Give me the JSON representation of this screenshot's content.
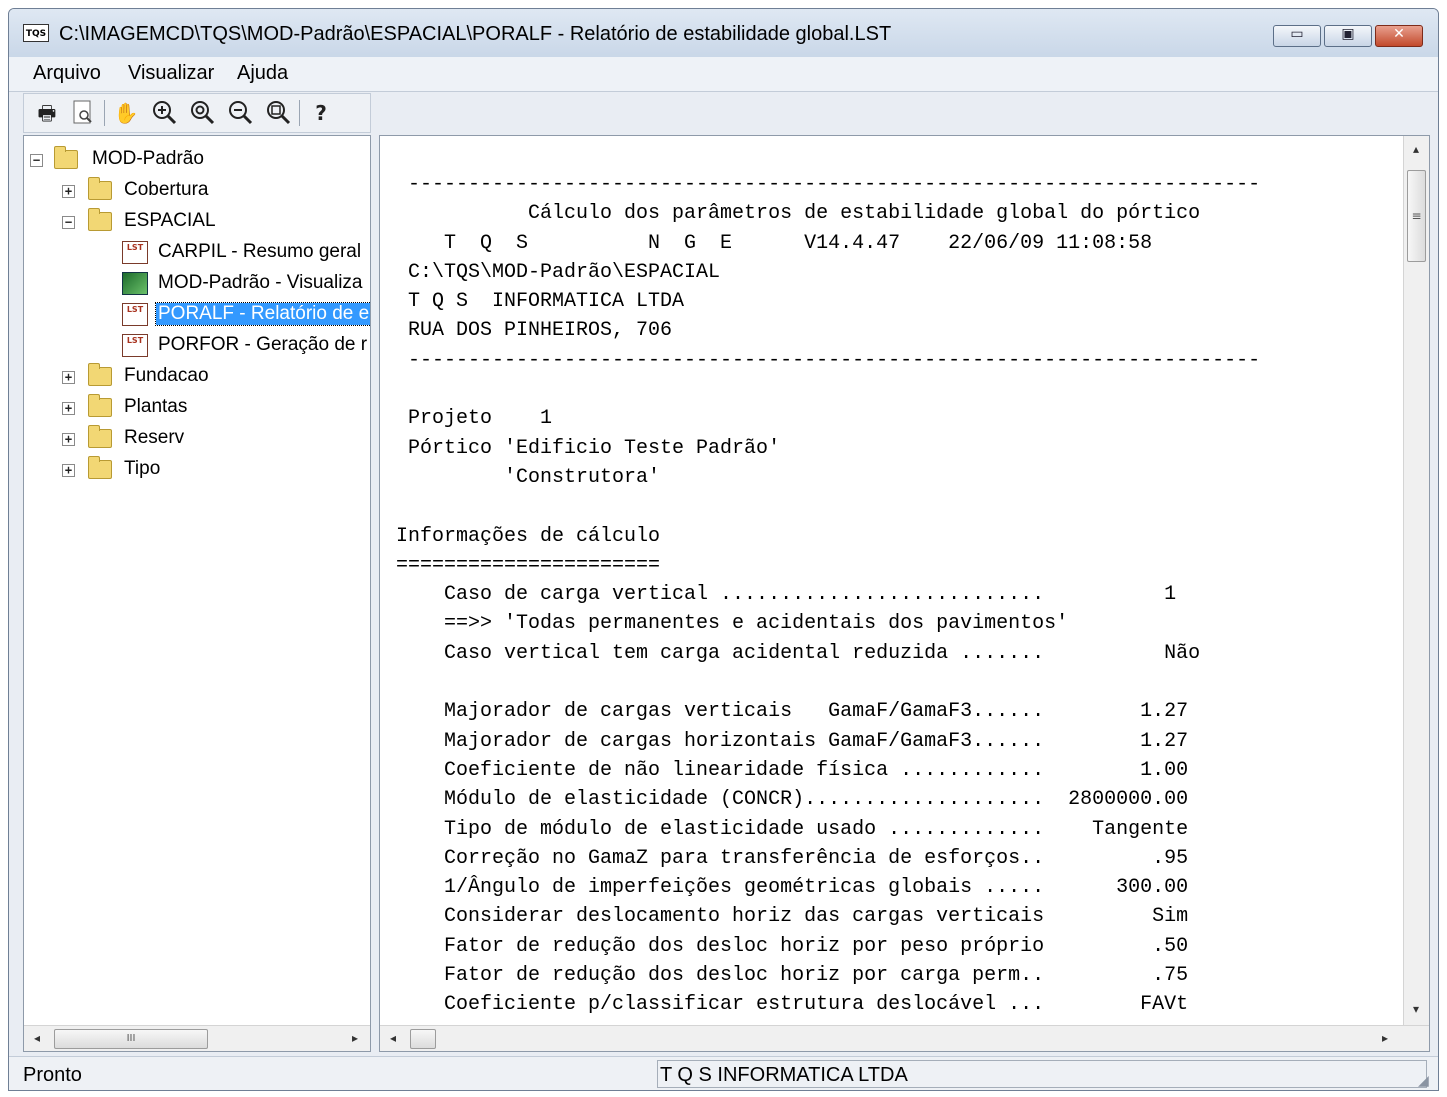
{
  "window": {
    "icon_text": "TQS",
    "title": "C:\\IMAGEMCD\\TQS\\MOD-Padrão\\ESPACIAL\\PORALF - Relatório de estabilidade global.LST",
    "minimize_glyph": "▭",
    "maximize_glyph": "▣",
    "close_glyph": "✕"
  },
  "menu": {
    "arquivo": "Arquivo",
    "visualizar": "Visualizar",
    "ajuda": "Ajuda"
  },
  "toolbar": {
    "icons": [
      "printer-icon",
      "print-preview-icon",
      "hand-pan-icon",
      "zoom-in-icon",
      "zoom-window-icon",
      "zoom-out-icon",
      "zoom-all-icon",
      "help-icon"
    ]
  },
  "tree": {
    "root": "MOD-Padrão",
    "cobertura": "Cobertura",
    "espacial": "ESPACIAL",
    "carpil": "CARPIL - Resumo geral",
    "mod_padrao": "MOD-Padrão - Visualiza",
    "poralf": "PORALF - Relatório de e",
    "porfor": "PORFOR - Geração de r",
    "fundacao": "Fundacao",
    "plantas": "Plantas",
    "reserv": "Reserv",
    "tipo": "Tipo",
    "lst_badge": "LST"
  },
  "report": {
    "lines": [
      "  -----------------------------------------------------------------------",
      "            Cálculo dos parâmetros de estabilidade global do pórtico",
      "     T  Q  S          N  G  E      V14.4.47    22/06/09 11:08:58",
      "  C:\\TQS\\MOD-Padrão\\ESPACIAL",
      "  T Q S  INFORMATICA LTDA",
      "  RUA DOS PINHEIROS, 706",
      "  -----------------------------------------------------------------------",
      "",
      "  Projeto    1",
      "  Pórtico 'Edificio Teste Padrão'",
      "          'Construtora'",
      "",
      " Informações de cálculo",
      " ======================",
      "     Caso de carga vertical ...........................          1",
      "     ==>> 'Todas permanentes e acidentais dos pavimentos'",
      "     Caso vertical tem carga acidental reduzida .......          Não",
      "",
      "     Majorador de cargas verticais   GamaF/GamaF3......        1.27",
      "     Majorador de cargas horizontais GamaF/GamaF3......        1.27",
      "     Coeficiente de não linearidade física ............        1.00",
      "     Módulo de elasticidade (CONCR)....................  2800000.00",
      "     Tipo de módulo de elasticidade usado .............    Tangente",
      "     Correção no GamaZ para transferência de esforços..         .95",
      "     1/Ângulo de imperfeições geométricas globais .....      300.00",
      "     Considerar deslocamento horiz das cargas verticais         Sim",
      "     Fator de redução dos desloc horiz por peso próprio         .50",
      "     Fator de redução dos desloc horiz por carga perm..         .75",
      "     Coeficiente p/classificar estrutura deslocável ...        FAVt"
    ]
  },
  "scrollbars": {
    "thumb_grip_h": "III",
    "thumb_grip_v": "≡"
  },
  "status": {
    "left": "Pronto",
    "right": "T Q S INFORMATICA LTDA"
  }
}
